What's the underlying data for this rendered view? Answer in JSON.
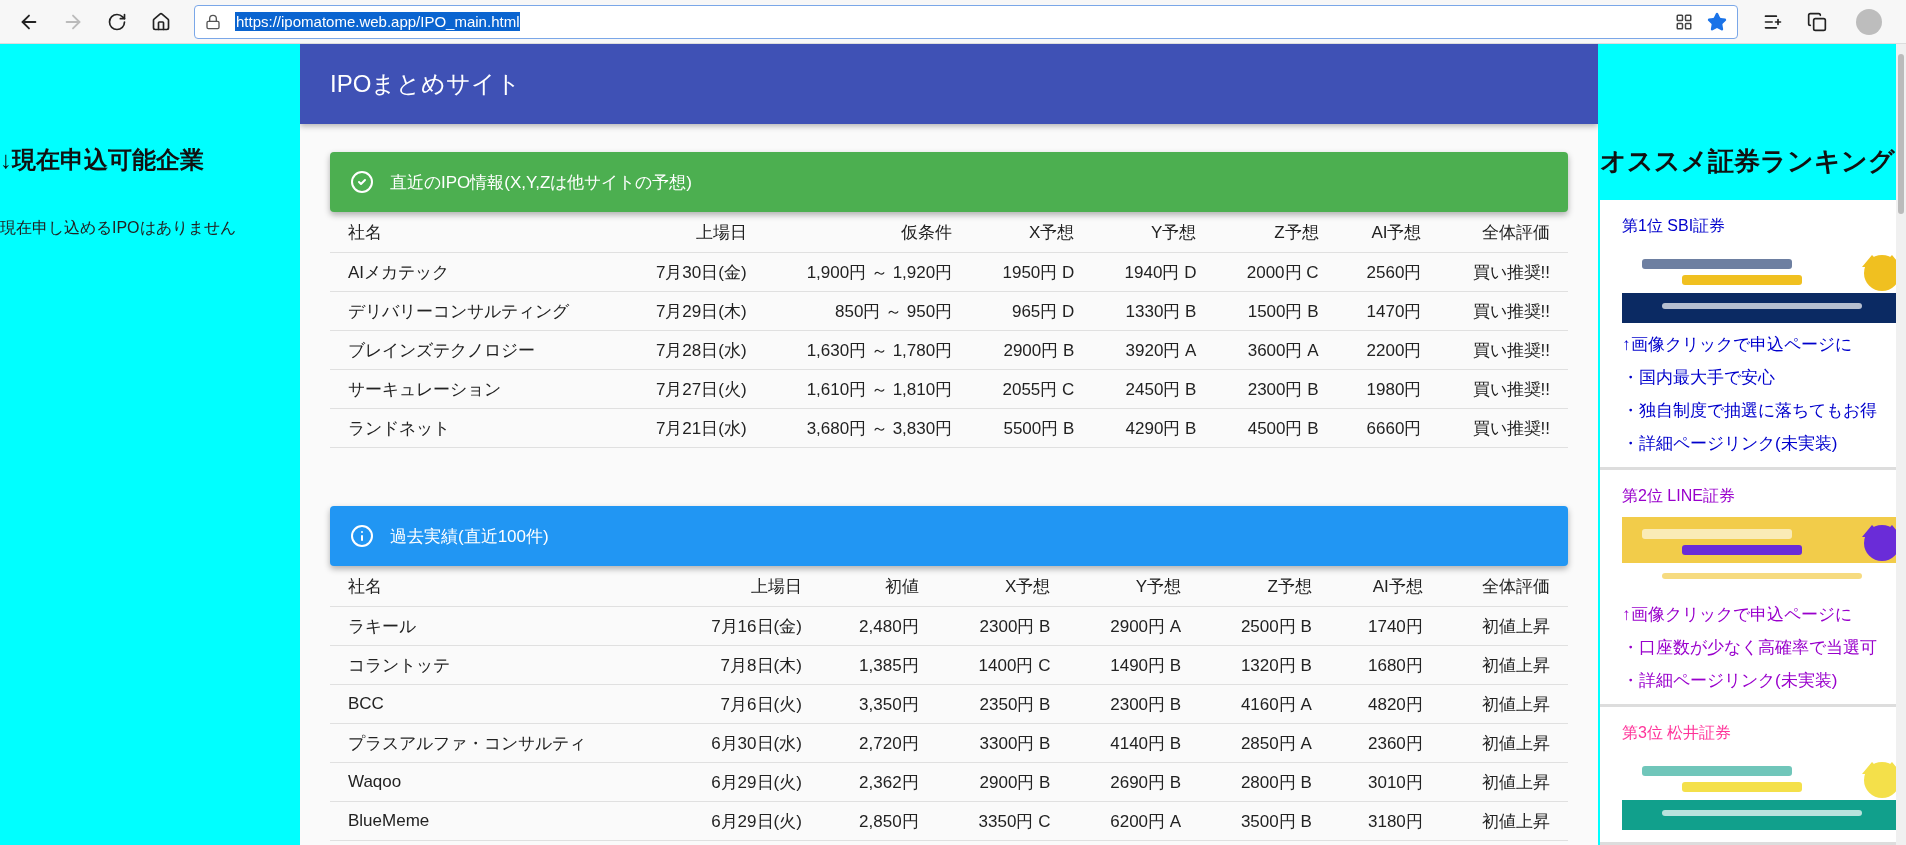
{
  "browser": {
    "url": "https://ipomatome.web.app/IPO_main.html",
    "back_disabled": false,
    "forward_disabled": true,
    "favorited": true
  },
  "left": {
    "heading": "↓現在申込可能企業",
    "message": "現在申し込めるIPOはありません"
  },
  "header": {
    "title": "IPOまとめサイト"
  },
  "sections": [
    {
      "kind": "success",
      "title": "直近のIPO情報(X,Y,Zは他サイトの予想)",
      "columns": [
        "社名",
        "上場日",
        "仮条件",
        "X予想",
        "Y予想",
        "Z予想",
        "AI予想",
        "全体評価"
      ],
      "rows": [
        [
          "AIメカテック",
          "7月30日(金)",
          "1,900円 ～ 1,920円",
          "1950円 D",
          "1940円 D",
          "2000円 C",
          "2560円",
          "買い推奨!!"
        ],
        [
          "デリバリーコンサルティング",
          "7月29日(木)",
          "850円 ～ 950円",
          "965円 D",
          "1330円 B",
          "1500円 B",
          "1470円",
          "買い推奨!!"
        ],
        [
          "ブレインズテクノロジー",
          "7月28日(水)",
          "1,630円 ～ 1,780円",
          "2900円 B",
          "3920円 A",
          "3600円 A",
          "2200円",
          "買い推奨!!"
        ],
        [
          "サーキュレーション",
          "7月27日(火)",
          "1,610円 ～ 1,810円",
          "2055円 C",
          "2450円 B",
          "2300円 B",
          "1980円",
          "買い推奨!!"
        ],
        [
          "ランドネット",
          "7月21日(水)",
          "3,680円 ～ 3,830円",
          "5500円 B",
          "4290円 B",
          "4500円 B",
          "6660円",
          "買い推奨!!"
        ]
      ]
    },
    {
      "kind": "info",
      "title": "過去実績(直近100件)",
      "columns": [
        "社名",
        "上場日",
        "初値",
        "X予想",
        "Y予想",
        "Z予想",
        "AI予想",
        "全体評価"
      ],
      "rows": [
        [
          "ラキール",
          "7月16日(金)",
          "2,480円",
          "2300円 B",
          "2900円 A",
          "2500円 B",
          "1740円",
          "初値上昇"
        ],
        [
          "コラントッテ",
          "7月8日(木)",
          "1,385円",
          "1400円 C",
          "1490円 B",
          "1320円 B",
          "1680円",
          "初値上昇"
        ],
        [
          "BCC",
          "7月6日(火)",
          "3,350円",
          "2350円 B",
          "2300円 B",
          "4160円 A",
          "4820円",
          "初値上昇"
        ],
        [
          "プラスアルファ・コンサルティ",
          "6月30日(水)",
          "2,720円",
          "3300円 B",
          "4140円 B",
          "2850円 A",
          "2360円",
          "初値上昇"
        ],
        [
          "Waqoo",
          "6月29日(火)",
          "2,362円",
          "2900円 B",
          "2690円 B",
          "2800円 B",
          "3010円",
          "初値上昇"
        ],
        [
          "BlueMeme",
          "6月29日(火)",
          "2,850円",
          "3350円 C",
          "6200円 A",
          "3500円 B",
          "3180円",
          "初値上昇"
        ]
      ]
    }
  ],
  "ranking": {
    "title": "オススメ証券ランキング",
    "items": [
      {
        "rank": "第1位 SBI証券",
        "color": "#0000cc",
        "banner": {
          "kind": "picture"
        },
        "note": "↑画像クリックで申込ページに",
        "bullets": [
          "・国内最大手で安心",
          "・独自制度で抽選に落ちてもお得",
          "・詳細ページリンク(未実装)"
        ]
      },
      {
        "rank": "第2位 LINE証券",
        "color": "#9900cc",
        "banner": {
          "kind": "picture"
        },
        "note": "↑画像クリックで申込ページに",
        "bullets": [
          "・口座数が少なく高確率で当選可",
          "・詳細ページリンク(未実装)"
        ]
      },
      {
        "rank": "第3位 松井証券",
        "color": "#ff3399",
        "banner": {
          "kind": "picture"
        }
      }
    ]
  }
}
